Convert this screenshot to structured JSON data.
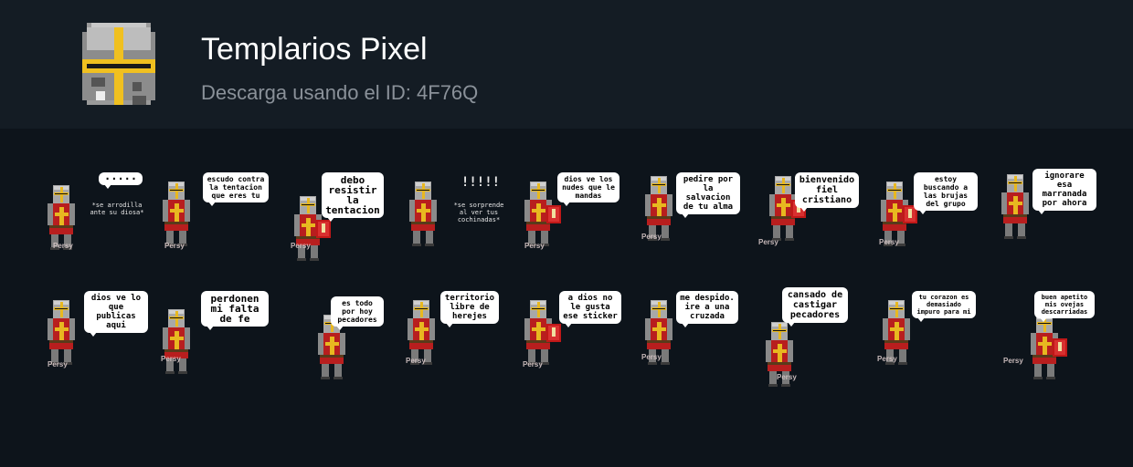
{
  "header": {
    "title": "Templarios Pixel",
    "subtitle": "Descarga usando el ID: 4F76Q"
  },
  "watermark": "Persy",
  "stickers": [
    {
      "text": "·····",
      "extra": "*se arrodilla ante su diosa*"
    },
    {
      "text": "Escudo contra la tentacion que eres tu"
    },
    {
      "text": "Debo resistir la tentacion"
    },
    {
      "text": "!!!!!",
      "extra": "*se sorprende al ver tus cochinadas*"
    },
    {
      "text": "Dios ve los nudes que le mandas"
    },
    {
      "text": "Pedire por la salvacion de tu alma"
    },
    {
      "text": "Bienvenido fiel cristiano"
    },
    {
      "text": "Estoy buscando a las brujas del grupo"
    },
    {
      "text": "Ignorare esa marranada por ahora"
    },
    {
      "text": "Dios ve lo que publicas aqui"
    },
    {
      "text": "Perdonen mi falta de fe"
    },
    {
      "text": "Es todo por hoy pecadores"
    },
    {
      "text": "Territorio libre de herejes"
    },
    {
      "text": "A Dios no le gusta ese sticker"
    },
    {
      "text": "Me despido. Ire a una cruzada"
    },
    {
      "text": "Cansado de castigar pecadores"
    },
    {
      "text": "Tu corazon es demasiado impuro para mi"
    },
    {
      "text": "Buen apetito mis ovejas descarriadas"
    }
  ]
}
